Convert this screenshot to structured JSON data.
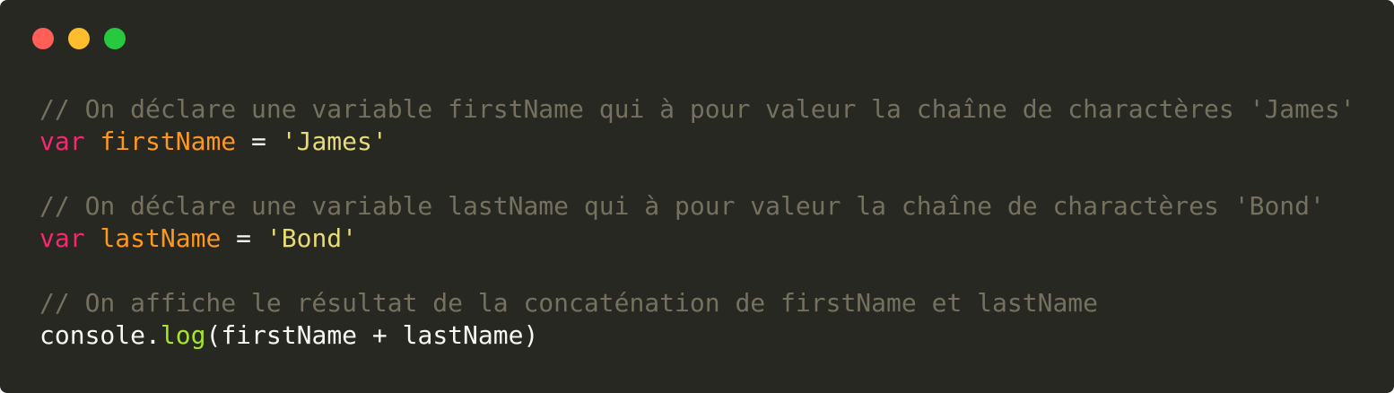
{
  "window": {
    "controls": [
      {
        "name": "close-button",
        "color": "#ff5f56"
      },
      {
        "name": "minimize-button",
        "color": "#ffbd2e"
      },
      {
        "name": "maximize-button",
        "color": "#27c93f"
      }
    ]
  },
  "colors": {
    "background": "#272822",
    "comment": "#75715e",
    "keyword": "#f92672",
    "variable": "#fd971f",
    "string": "#e6db74",
    "function": "#a6e22e",
    "default": "#f8f8f2"
  },
  "code": {
    "line1": {
      "comment": "// On déclare une variable firstName qui à pour valeur la chaîne de charactères 'James'"
    },
    "line2": {
      "keyword": "var",
      "variable": "firstName",
      "operator": "=",
      "string": "'James'"
    },
    "line4": {
      "comment": "// On déclare une variable lastName qui à pour valeur la chaîne de charactères 'Bond'"
    },
    "line5": {
      "keyword": "var",
      "variable": "lastName",
      "operator": "=",
      "string": "'Bond'"
    },
    "line7": {
      "comment": "// On affiche le résultat de la concaténation de firstName et lastName"
    },
    "line8": {
      "object": "console",
      "dot": ".",
      "method": "log",
      "open_paren": "(",
      "arg1": "firstName",
      "plus": "+",
      "arg2": "lastName",
      "close_paren": ")"
    }
  }
}
